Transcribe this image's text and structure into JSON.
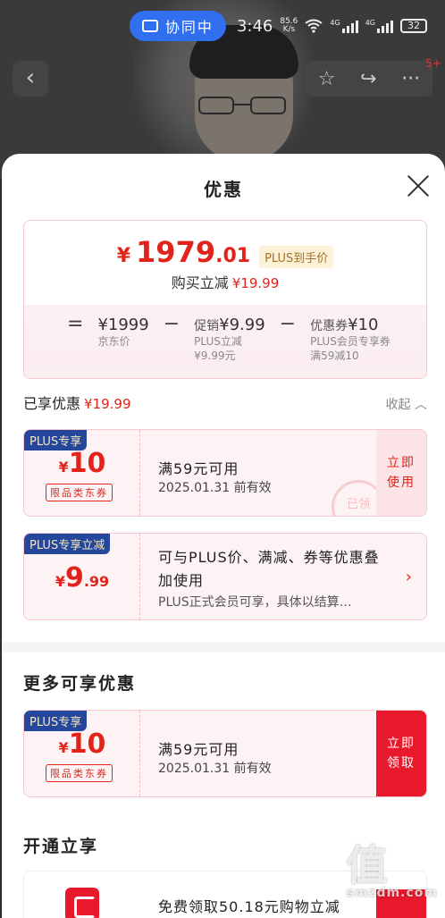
{
  "status_bar": {
    "cobrowse_label": "协同中",
    "time": "3:46",
    "net_speed_value": "85.6",
    "net_speed_unit": "K/s",
    "signal_1": "4G",
    "signal_2": "4G",
    "battery": "32"
  },
  "top_nav": {
    "notification_badge": "5+"
  },
  "sheet": {
    "title": "优惠",
    "price": {
      "yen": "¥",
      "integer": "1979",
      "decimal": ".01",
      "plus_tag": "PLUS到手价",
      "reduce_label": "购买立减",
      "reduce_amount": "¥19.99"
    },
    "breakdown": {
      "equals": "=",
      "base_price": "¥1999",
      "base_label": "京东价",
      "minus_1": "−",
      "promo_label": "促销",
      "promo_amount": "¥9.99",
      "promo_sub_1": "PLUS立减",
      "promo_sub_2": "¥9.99元",
      "minus_2": "−",
      "coupon_label": "优惠券",
      "coupon_amount": "¥10",
      "coupon_sub_1": "PLUS会员专享券",
      "coupon_sub_2": "满59减10"
    },
    "enjoyed": {
      "label": "已享优惠",
      "amount": "¥19.99",
      "collapse": "收起"
    },
    "coupons": [
      {
        "tag": "PLUS专享",
        "yen": "¥",
        "amount": "10",
        "kind": "限品类东券",
        "condition": "满59元可用",
        "validity": "2025.01.31 前有效",
        "action": "立即使用",
        "stamp": "已领"
      },
      {
        "tag": "PLUS专享立减",
        "yen": "¥",
        "amount": "9",
        "amount_decimal": ".99",
        "description": "可与PLUS价、满减、券等优惠叠加使用",
        "description_2": "PLUS正式会员可享，具体以结算…",
        "arrow": "›"
      }
    ],
    "more": {
      "title": "更多可享优惠",
      "coupon": {
        "tag": "PLUS专享",
        "yen": "¥",
        "amount": "10",
        "kind": "限品类东券",
        "condition": "满59元可用",
        "validity": "2025.01.31 前有效",
        "action": "立即领取"
      }
    },
    "open": {
      "title": "开通立享",
      "text": "免费领取50.18元购物立减"
    }
  },
  "watermark": {
    "logo": "值",
    "site": "smzdm.com"
  },
  "colors": {
    "accent_red": "#e2231a",
    "plus_blue": "#24479c",
    "cobrowse_blue": "#2f6ff0"
  },
  "icons": [
    "cobrowse-icon",
    "wifi-icon",
    "back-arrow-icon",
    "star-icon",
    "share-icon",
    "more-icon",
    "close-icon",
    "chevron-up-icon",
    "chevron-right-icon",
    "jd-logo-icon"
  ]
}
